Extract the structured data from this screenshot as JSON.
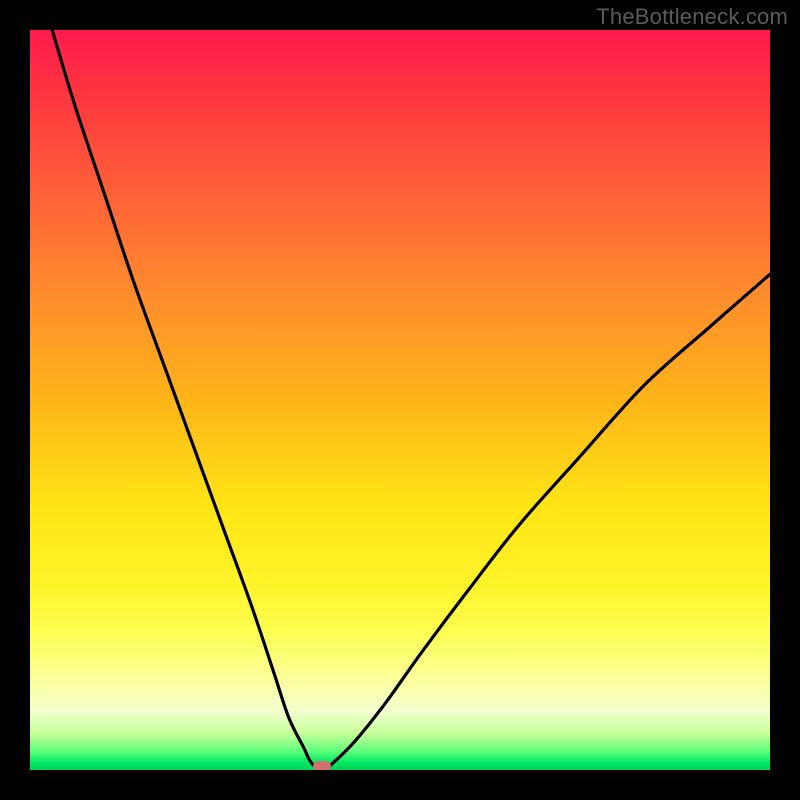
{
  "watermark": "TheBottleneck.com",
  "chart_data": {
    "type": "line",
    "title": "",
    "xlabel": "",
    "ylabel": "",
    "xlim": [
      0,
      100
    ],
    "ylim": [
      0,
      100
    ],
    "grid": false,
    "legend": false,
    "series": [
      {
        "name": "bottleneck-curve",
        "x": [
          3,
          6,
          10,
          14,
          18,
          22,
          26,
          30,
          33,
          35,
          37,
          38,
          39.5,
          41,
          44,
          48,
          53,
          59,
          66,
          74,
          83,
          92,
          100
        ],
        "values": [
          100,
          90,
          78,
          66,
          55,
          44,
          33,
          22,
          13,
          7,
          3,
          1,
          0,
          1,
          4,
          9,
          16,
          24,
          33,
          42,
          52,
          60,
          67
        ]
      }
    ],
    "annotations": [
      {
        "kind": "marker",
        "shape": "rounded-rect",
        "x": 39.5,
        "y": 0,
        "color": "#d07070"
      }
    ],
    "background_gradient": {
      "direction": "vertical",
      "stops": [
        {
          "pos": 0,
          "color": "#ff1a4d"
        },
        {
          "pos": 0.35,
          "color": "#ff8a2e"
        },
        {
          "pos": 0.64,
          "color": "#ffe415"
        },
        {
          "pos": 0.88,
          "color": "#fbffa0"
        },
        {
          "pos": 0.99,
          "color": "#00e864"
        },
        {
          "pos": 1.0,
          "color": "#00d05a"
        }
      ]
    }
  }
}
